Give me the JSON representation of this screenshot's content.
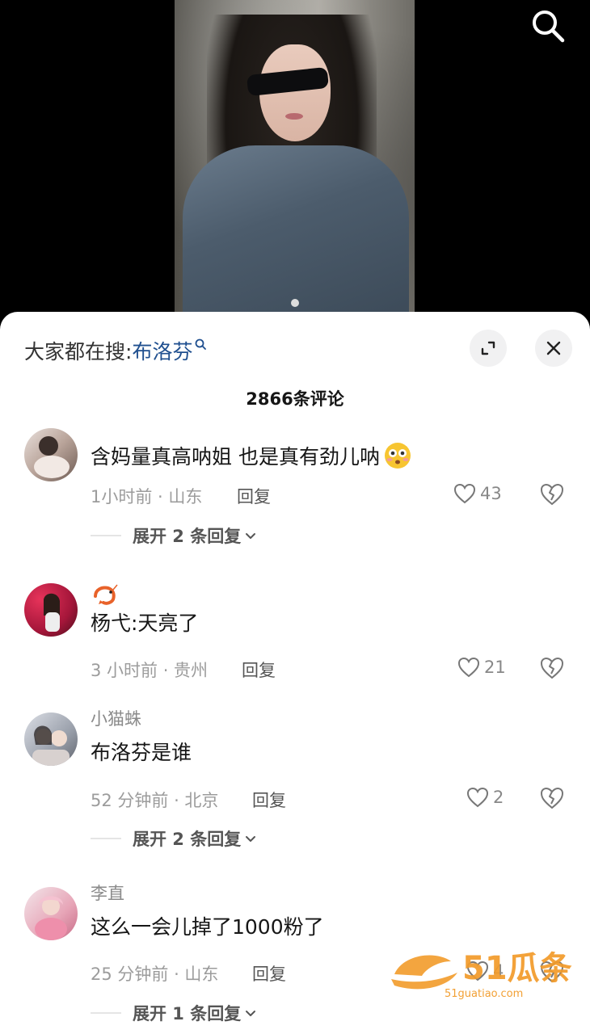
{
  "video": {
    "search_icon": "search-icon"
  },
  "panel": {
    "suggest_prefix": "大家都在搜:",
    "suggest_keyword": "布洛芬",
    "comment_count": "2866条评论"
  },
  "comments": [
    {
      "username": "",
      "text": "含妈量真高呐姐 也是真有劲儿呐",
      "time_location": "1小时前 · 山东",
      "reply": "回复",
      "likes": "43",
      "expand": "展开 2 条回复"
    },
    {
      "username": "",
      "text": "杨弋:天亮了",
      "time_location": "3 小时前 · 贵州",
      "reply": "回复",
      "likes": "21"
    },
    {
      "username": "小猫蛛",
      "text": "布洛芬是谁",
      "time_location": "52 分钟前 · 北京",
      "reply": "回复",
      "likes": "2",
      "expand": "展开 2 条回复"
    },
    {
      "username": "李直",
      "text": "这么一会儿掉了1000粉了",
      "time_location": "25 分钟前 · 山东",
      "reply": "回复",
      "likes": "4",
      "expand": "展开 1 条回复"
    }
  ],
  "watermark": {
    "brand": "51瓜条",
    "url": "51guatiao.com"
  },
  "colors": {
    "keyword": "#1f4f8f",
    "watermark": "#f29b2a"
  }
}
